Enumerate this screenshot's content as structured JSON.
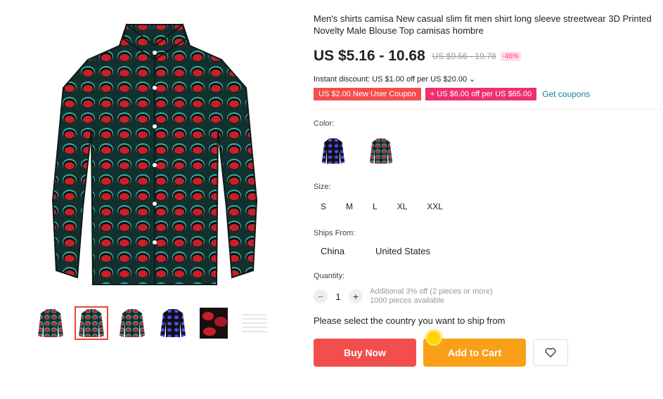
{
  "product": {
    "title": "Men's shirts camisa New casual slim fit men shirt long sleeve streetwear 3D Printed Novelty Male Blouse Top camisas hombre",
    "price": "US $5.16 - 10.68",
    "original_price": "US $9.56 - 19.78",
    "discount": "-46%"
  },
  "promo": {
    "instant_discount": "Instant discount: US $1.00 off per US $20.00 ⌄",
    "coupon_1": "US $2.00 New User Coupon",
    "coupon_2": "+ US $6.00 off per US $65.00",
    "get_coupons": "Get coupons"
  },
  "options": {
    "color_label": "Color:",
    "size_label": "Size:",
    "sizes": [
      "S",
      "M",
      "L",
      "XL",
      "XXL"
    ],
    "ships_label": "Ships From:",
    "ships": [
      "China",
      "United States"
    ],
    "quantity_label": "Quantity:",
    "quantity": "1",
    "minus": "−",
    "plus": "+",
    "qty_note_1": "Additional 3% off (2 pieces or more)",
    "qty_note_2": "1000 pieces available"
  },
  "ship_note": "Please select the country you want to ship from",
  "actions": {
    "buy_now": "Buy Now",
    "add_to_cart": "Add to Cart",
    "wishlist_icon": "heart-icon"
  },
  "colors": {
    "accent_red": "#f34e4e",
    "accent_orange": "#fa9f18",
    "link": "#1a7f9e"
  }
}
